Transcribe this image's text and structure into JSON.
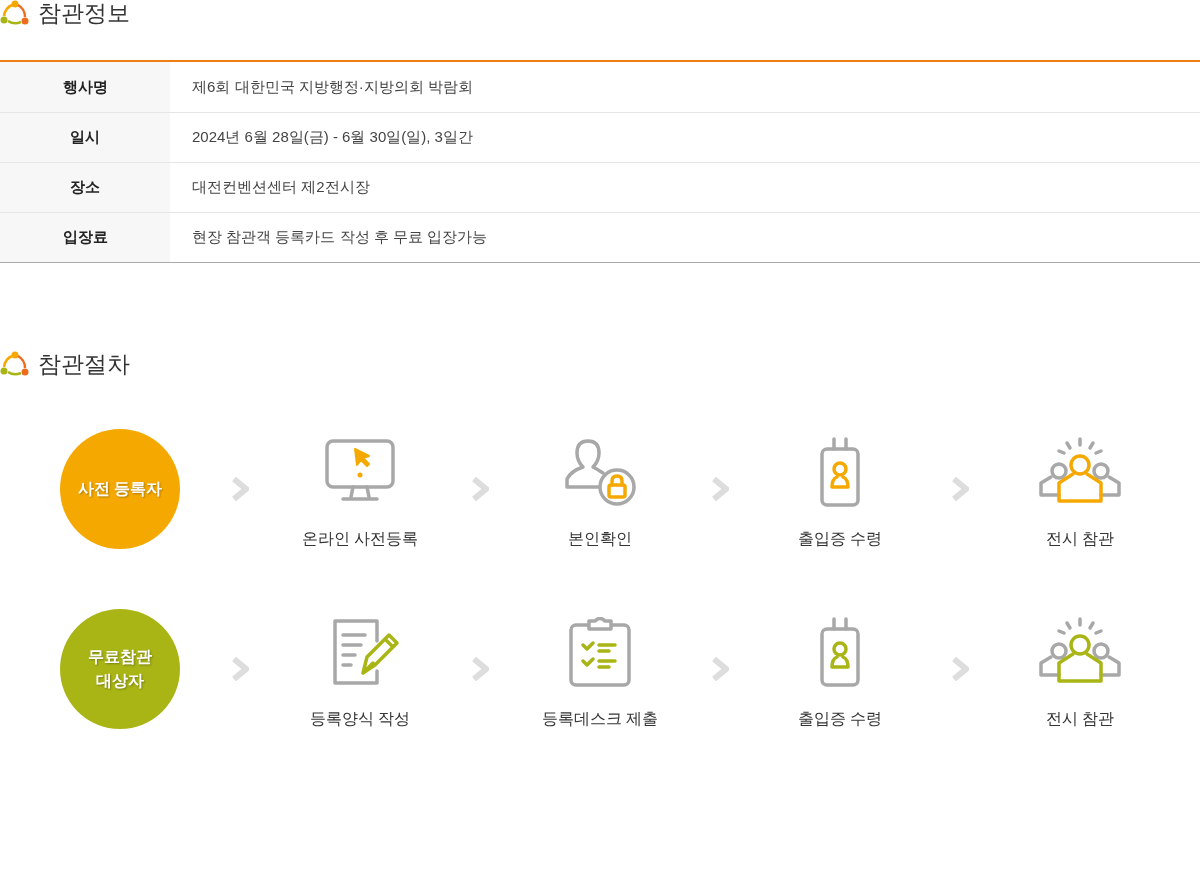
{
  "info_section": {
    "title": "참관정보",
    "rows": [
      {
        "label": "행사명",
        "value": "제6회 대한민국 지방행정·지방의회 박람회"
      },
      {
        "label": "일시",
        "value": "2024년 6월 28일(금) - 6월 30일(일), 3일간"
      },
      {
        "label": "장소",
        "value": "대전컨벤션센터 제2전시장"
      },
      {
        "label": "입장료",
        "value": "현장 참관객 등록카드 작성 후 무료 입장가능"
      }
    ]
  },
  "procedure_section": {
    "title": "참관절차",
    "groups": [
      {
        "label": "사전 등록자",
        "color": "#f5a900",
        "steps": [
          {
            "kind": "monitor",
            "label": "온라인 사전등록"
          },
          {
            "kind": "user-lock",
            "label": "본인확인"
          },
          {
            "kind": "badge",
            "label": "출입증 수령"
          },
          {
            "kind": "crowd",
            "label": "전시 참관"
          }
        ]
      },
      {
        "label": "무료참관\n대상자",
        "color": "#a9b515",
        "steps": [
          {
            "kind": "form",
            "label": "등록양식 작성"
          },
          {
            "kind": "clipboard",
            "label": "등록데스크 제출"
          },
          {
            "kind": "badge",
            "label": "출입증 수령"
          },
          {
            "kind": "crowd",
            "label": "전시 참관"
          }
        ]
      }
    ]
  }
}
